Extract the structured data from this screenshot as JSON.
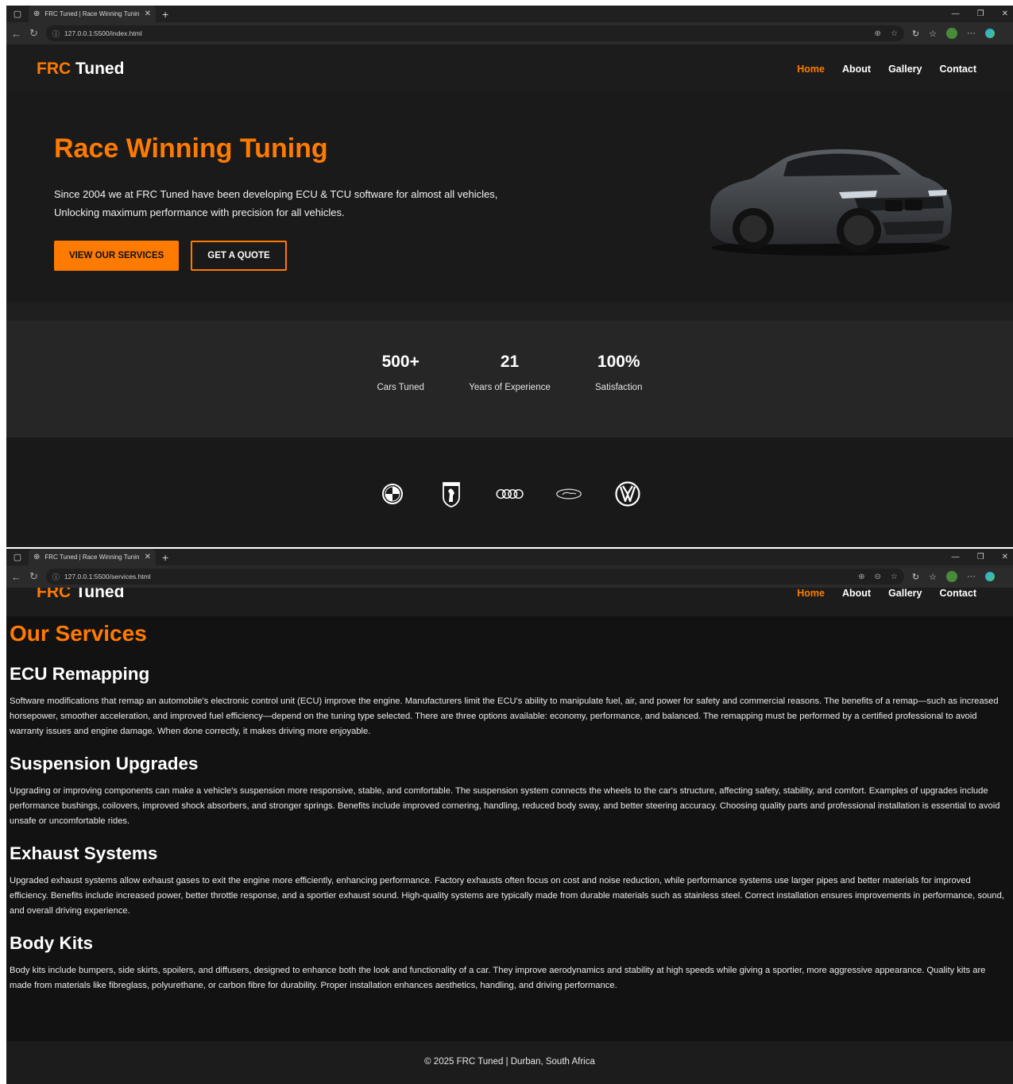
{
  "browser": {
    "tab_title": "FRC Tuned | Race Winning Tunin",
    "home_url": "127.0.0.1:5500/index.html",
    "services_url": "127.0.0.1:5500/services.html"
  },
  "site": {
    "logo_accent": "FRC",
    "logo_rest": " Tuned",
    "nav": [
      "Home",
      "About",
      "Gallery",
      "Contact"
    ]
  },
  "hero": {
    "title": "Race Winning Tuning",
    "text": "Since 2004 we at FRC Tuned have been developing ECU & TCU software for almost all vehicles, Unlocking maximum performance with precision for all vehicles.",
    "primary_button": "VIEW OUR SERVICES",
    "secondary_button": "GET A QUOTE"
  },
  "stats": [
    {
      "value": "500+",
      "label": "Cars Tuned"
    },
    {
      "value": "21",
      "label": "Years of Experience"
    },
    {
      "value": "100%",
      "label": "Satisfaction"
    }
  ],
  "brands": [
    "bmw-logo-icon",
    "ferrari-logo-icon",
    "audi-logo-icon",
    "ford-logo-icon",
    "volkswagen-logo-icon"
  ],
  "services": {
    "title": "Our Services",
    "items": [
      {
        "heading": "ECU Remapping",
        "text": "Software modifications that remap an automobile's electronic control unit (ECU) improve the engine. Manufacturers limit the ECU's ability to manipulate fuel, air, and power for safety and commercial reasons. The benefits of a remap—such as increased horsepower, smoother acceleration, and improved fuel efficiency—depend on the tuning type selected. There are three options available: economy, performance, and balanced. The remapping must be performed by a certified professional to avoid warranty issues and engine damage. When done correctly, it makes driving more enjoyable."
      },
      {
        "heading": "Suspension Upgrades",
        "text": "Upgrading or improving components can make a vehicle's suspension more responsive, stable, and comfortable. The suspension system connects the wheels to the car's structure, affecting safety, stability, and comfort. Examples of upgrades include performance bushings, coilovers, improved shock absorbers, and stronger springs. Benefits include improved cornering, handling, reduced body sway, and better steering accuracy. Choosing quality parts and professional installation is essential to avoid unsafe or uncomfortable rides."
      },
      {
        "heading": "Exhaust Systems",
        "text": "Upgraded exhaust systems allow exhaust gases to exit the engine more efficiently, enhancing performance. Factory exhausts often focus on cost and noise reduction, while performance systems use larger pipes and better materials for improved efficiency. Benefits include increased power, better throttle response, and a sportier exhaust sound. High-quality systems are typically made from durable materials such as stainless steel. Correct installation ensures improvements in performance, sound, and overall driving experience."
      },
      {
        "heading": "Body Kits",
        "text": "Body kits include bumpers, side skirts, spoilers, and diffusers, designed to enhance both the look and functionality of a car. They improve aerodynamics and stability at high speeds while giving a sportier, more aggressive appearance. Quality kits are made from materials like fibreglass, polyurethane, or carbon fibre for durability. Proper installation enhances aesthetics, handling, and driving performance."
      }
    ]
  },
  "footer": "© 2025 FRC Tuned | Durban, South Africa",
  "colors": {
    "accent": "#ff7a00",
    "background": "#1c1c1c"
  }
}
